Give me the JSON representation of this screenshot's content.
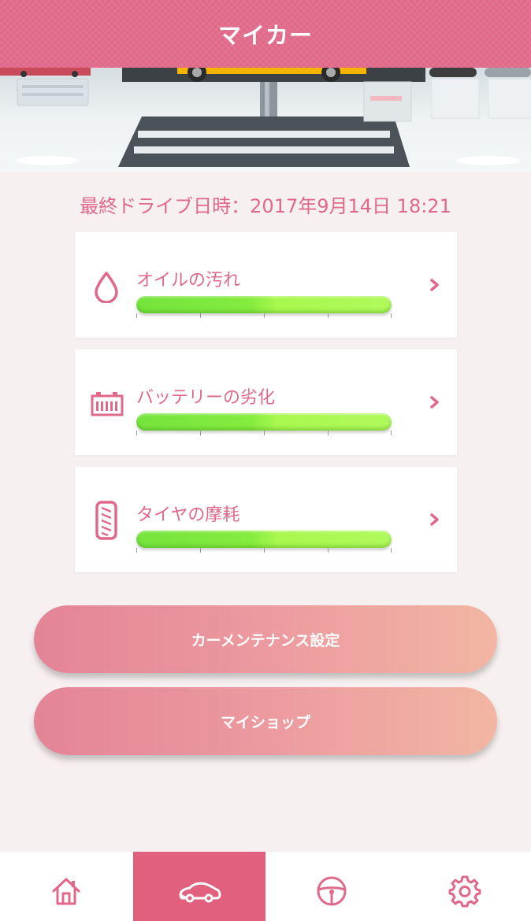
{
  "header": {
    "title": "マイカー"
  },
  "last_drive": {
    "text": "最終ドライブ日時：2017年9月14日 18:21"
  },
  "status_items": [
    {
      "label": "オイルの汚れ",
      "icon": "oil-drop-icon",
      "level_percent": 100
    },
    {
      "label": "バッテリーの劣化",
      "icon": "battery-icon",
      "level_percent": 100
    },
    {
      "label": "タイヤの摩耗",
      "icon": "tire-icon",
      "level_percent": 100
    }
  ],
  "buttons": {
    "maintenance_label": "カーメンテナンス設定",
    "myshop_label": "マイショップ"
  },
  "tabbar": {
    "tabs": [
      {
        "icon": "home-icon",
        "active": false
      },
      {
        "icon": "car-icon",
        "active": true
      },
      {
        "icon": "steering-wheel-icon",
        "active": false
      },
      {
        "icon": "gear-icon",
        "active": false
      }
    ]
  },
  "colors": {
    "accent": "#e0698a",
    "active_tab": "#e0607e",
    "bar_green": "#85ec3e",
    "background": "#f7f0f0"
  }
}
